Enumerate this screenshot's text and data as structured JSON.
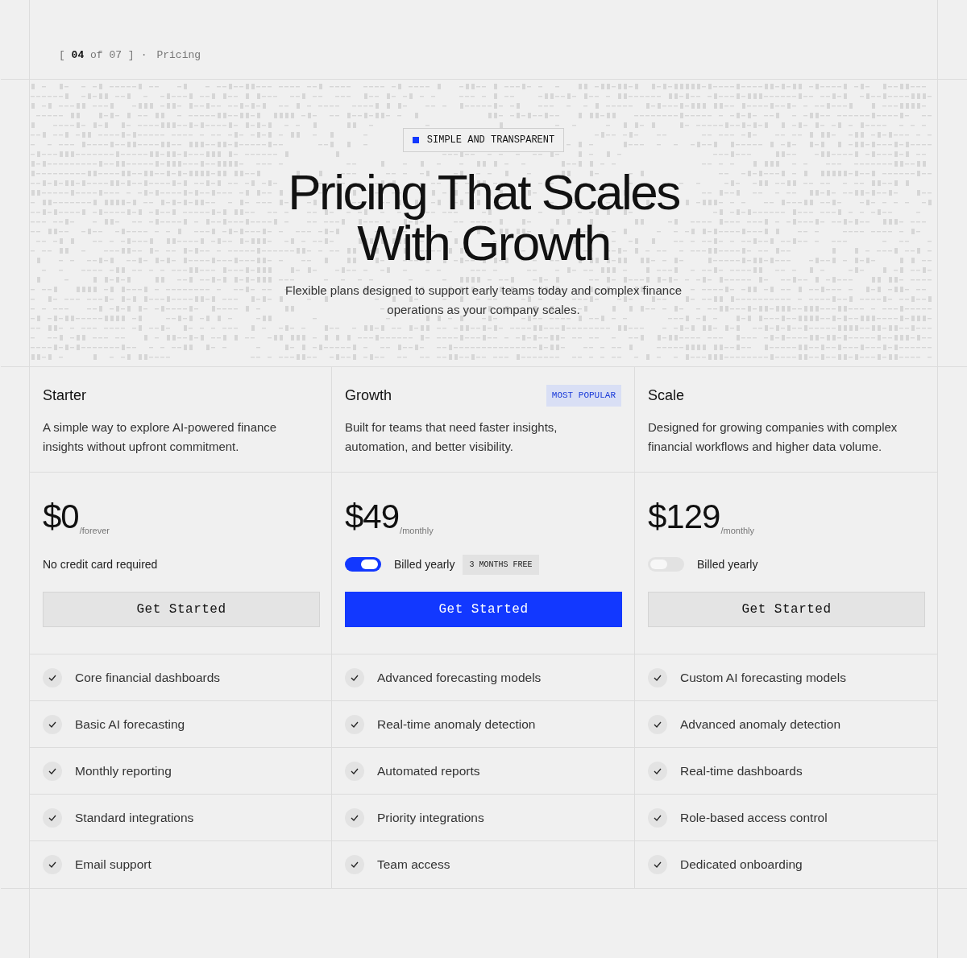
{
  "header": {
    "counter": "[ **04** of 07 ]",
    "separator": "·",
    "section": "Pricing"
  },
  "hero": {
    "tag": "SIMPLE AND TRANSPARENT",
    "title_lines": [
      "Pricing That Scales",
      "With Growth"
    ],
    "subtitle": "Flexible plans designed to support early teams today and complex finance operations as your company scales."
  },
  "plans": [
    {
      "name": "Starter",
      "description": "A simple way to explore AI-powered finance insights without upfront commitment.",
      "price": "$0",
      "period": "/forever",
      "billing": {
        "kind": "note",
        "text": "No credit card required"
      },
      "button": {
        "label": "Get Started",
        "highlighted": false
      },
      "features": [
        "Core financial dashboards",
        "Basic AI forecasting",
        "Monthly reporting",
        "Standard integrations",
        "Email support"
      ]
    },
    {
      "name": "Growth",
      "badge": "MOST POPULAR",
      "description": "Built for teams that need faster insights, automation, and better visibility.",
      "price": "$49",
      "period": "/monthly",
      "billing": {
        "kind": "toggle",
        "on": true,
        "text": "Billed yearly",
        "offer": "3 MONTHS FREE"
      },
      "button": {
        "label": "Get Started",
        "highlighted": true
      },
      "features": [
        "Advanced forecasting models",
        "Real-time anomaly detection",
        "Automated reports",
        "Priority integrations",
        "Team access"
      ]
    },
    {
      "name": "Scale",
      "description": "Designed for growing companies with complex financial workflows and higher data volume.",
      "price": "$129",
      "period": "/monthly",
      "billing": {
        "kind": "toggle",
        "on": false,
        "text": "Billed yearly"
      },
      "button": {
        "label": "Get Started",
        "highlighted": false
      },
      "features": [
        "Custom AI forecasting models",
        "Advanced anomaly detection",
        "Real-time dashboards",
        "Role-based access control",
        "Dedicated onboarding"
      ]
    }
  ]
}
